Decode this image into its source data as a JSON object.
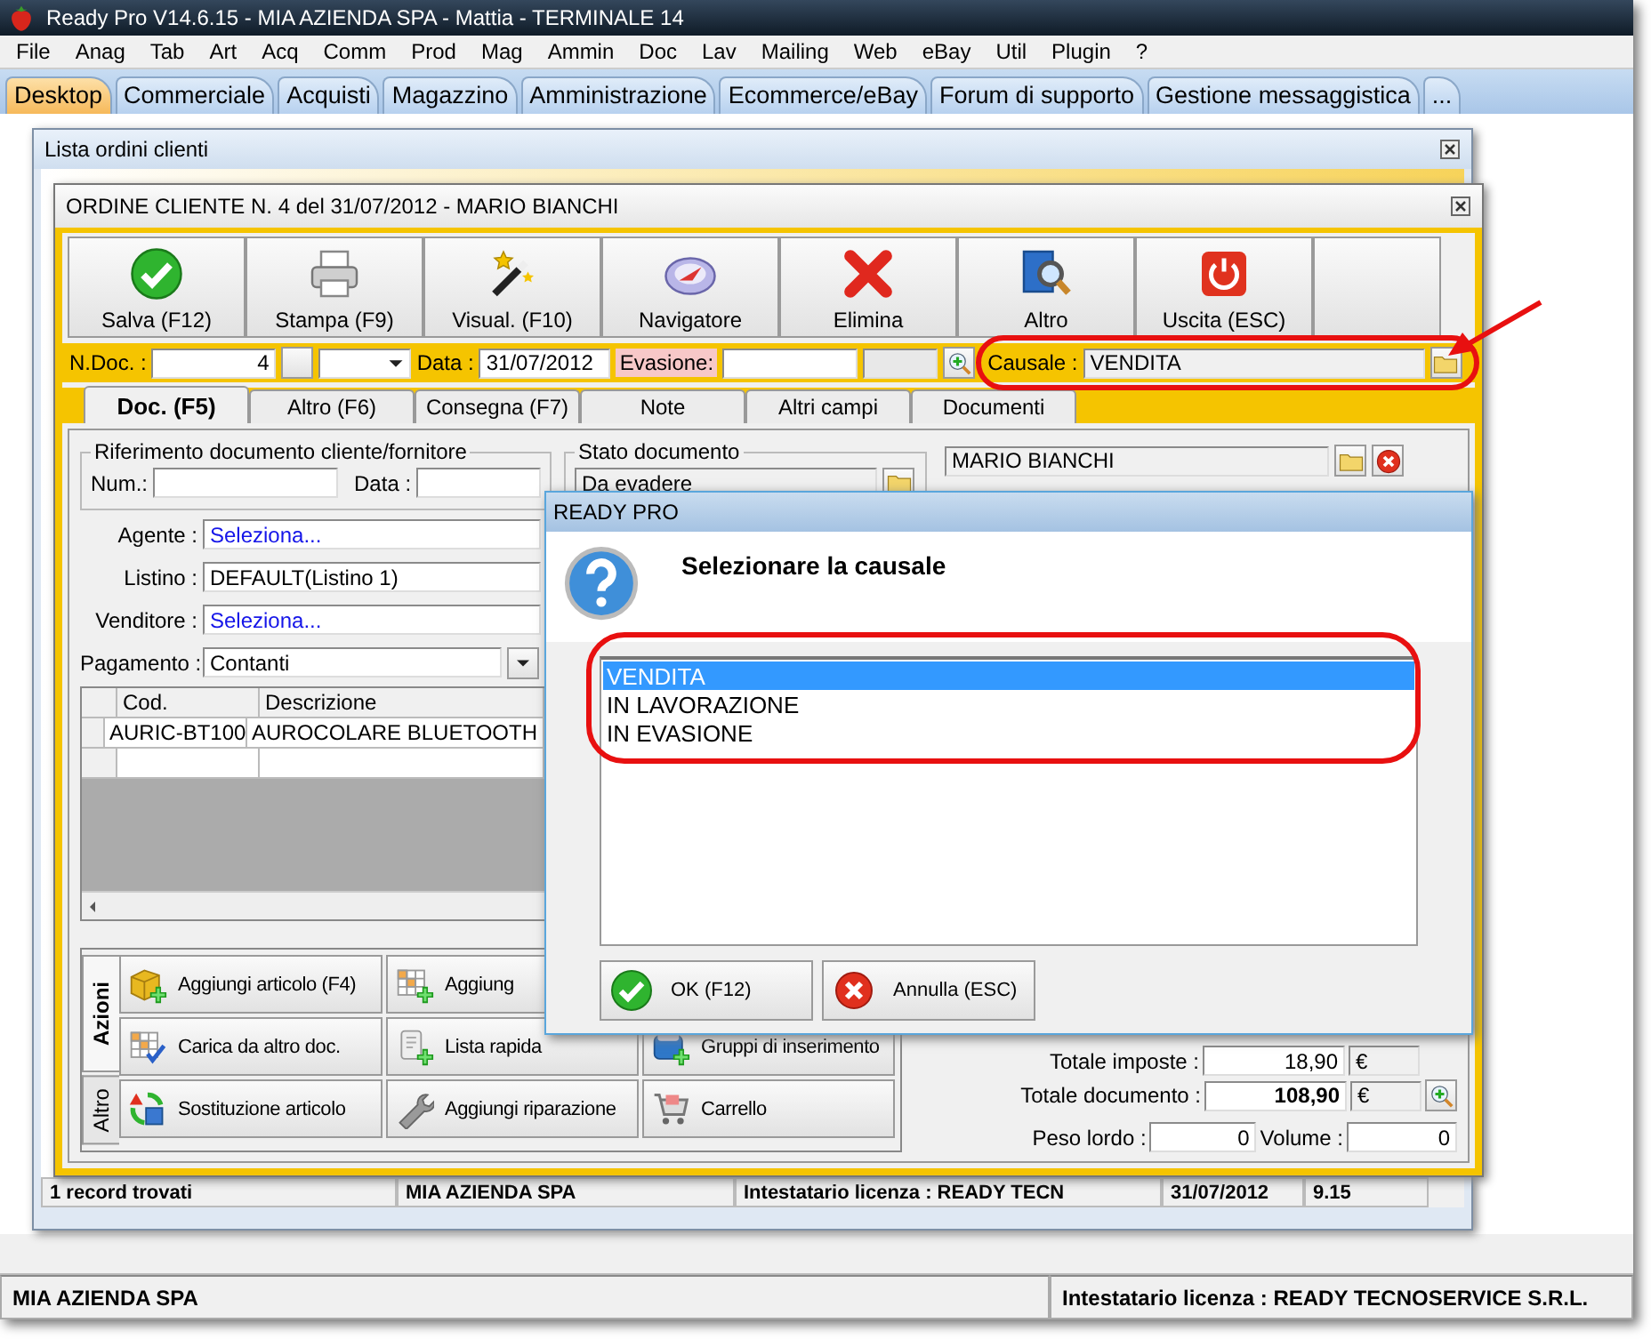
{
  "app": {
    "title": "Ready Pro V14.6.15 - MIA AZIENDA SPA - Mattia - TERMINALE 14"
  },
  "menu": [
    "File",
    "Anag",
    "Tab",
    "Art",
    "Acq",
    "Comm",
    "Prod",
    "Mag",
    "Ammin",
    "Doc",
    "Lav",
    "Mailing",
    "Web",
    "eBay",
    "Util",
    "Plugin",
    "?"
  ],
  "tabs": [
    {
      "label": "Desktop",
      "selected": true
    },
    {
      "label": "Commerciale",
      "selected": false
    },
    {
      "label": "Acquisti",
      "selected": false
    },
    {
      "label": "Magazzino",
      "selected": false
    },
    {
      "label": "Amministrazione",
      "selected": false
    },
    {
      "label": "Ecommerce/eBay",
      "selected": false
    },
    {
      "label": "Forum di supporto",
      "selected": false
    },
    {
      "label": "Gestione messaggistica",
      "selected": false
    },
    {
      "label": "...",
      "selected": false
    }
  ],
  "list_window": {
    "title": "Lista ordini clienti",
    "status_bar": [
      "1 record trovati",
      "MIA AZIENDA SPA",
      "Intestatario licenza : READY TECN",
      "31/07/2012",
      "9.15"
    ]
  },
  "order_window": {
    "title": "ORDINE CLIENTE N. 4  del 31/07/2012 - MARIO BIANCHI",
    "toolbar": [
      "Salva (F12)",
      "Stampa (F9)",
      "Visual. (F10)",
      "Navigatore",
      "Elimina",
      "Altro",
      "Uscita (ESC)"
    ],
    "header": {
      "ndoc_label": "N.Doc. :",
      "ndoc": "4",
      "data_label": "Data :",
      "data": "31/07/2012",
      "evasione_label": "Evasione:",
      "causale_label": "Causale :",
      "causale": "VENDITA"
    },
    "tabs": [
      {
        "label": "Doc. (F5)",
        "selected": true
      },
      {
        "label": "Altro (F6)",
        "selected": false
      },
      {
        "label": "Consegna (F7)",
        "selected": false
      },
      {
        "label": "Note",
        "selected": false
      },
      {
        "label": "Altri campi",
        "selected": false
      },
      {
        "label": "Documenti",
        "selected": false
      }
    ],
    "riferimento": {
      "legend": "Riferimento documento cliente/fornitore",
      "num_label": "Num.:",
      "data_label": "Data :"
    },
    "fields": [
      {
        "label": "Agente :",
        "value": "Seleziona...",
        "kind": "link"
      },
      {
        "label": "Listino :",
        "value": "DEFAULT(Listino 1)",
        "kind": "text"
      },
      {
        "label": "Venditore :",
        "value": "Seleziona...",
        "kind": "link"
      },
      {
        "label": "Pagamento :",
        "value": "Contanti",
        "kind": "dropdown"
      }
    ],
    "grid": {
      "columns": [
        "Cod.",
        "Descrizione"
      ],
      "rows": [
        [
          "AURIC-BT100",
          "AUROCOLARE BLUETOOTH"
        ]
      ]
    },
    "stato": {
      "legend": "Stato documento",
      "value": "Da evadere"
    },
    "customer": "MARIO BIANCHI",
    "side_tabs": [
      {
        "label": "Azioni",
        "selected": true
      },
      {
        "label": "Altro",
        "selected": false
      }
    ],
    "actions": [
      "Aggiungi articolo (F4)",
      "Aggiung",
      "Carica da altro doc.",
      "Lista rapida",
      "Gruppi di inserimento",
      "Sostituzione articolo",
      "Aggiungi riparazione",
      "Carrello"
    ],
    "totals": [
      {
        "label": "Totale imposte :",
        "value": "18,90",
        "currency": "€",
        "bold": false
      },
      {
        "label": "Totale documento :",
        "value": "108,90",
        "currency": "€",
        "bold": true
      }
    ],
    "peso": {
      "label": "Peso lordo :",
      "value": "0"
    },
    "volume": {
      "label": "Volume :",
      "value": "0"
    }
  },
  "dialog": {
    "title": "READY PRO",
    "message": "Selezionare la causale",
    "options": [
      {
        "label": "VENDITA",
        "selected": true
      },
      {
        "label": "IN LAVORAZIONE",
        "selected": false
      },
      {
        "label": "IN EVASIONE",
        "selected": false
      }
    ],
    "buttons": [
      {
        "label": "OK (F12)",
        "kind": "ok"
      },
      {
        "label": "Annulla (ESC)",
        "kind": "cancel"
      }
    ]
  },
  "status_bar": [
    "MIA AZIENDA SPA",
    "Intestatario licenza : READY TECNOSERVICE S.R.L."
  ]
}
